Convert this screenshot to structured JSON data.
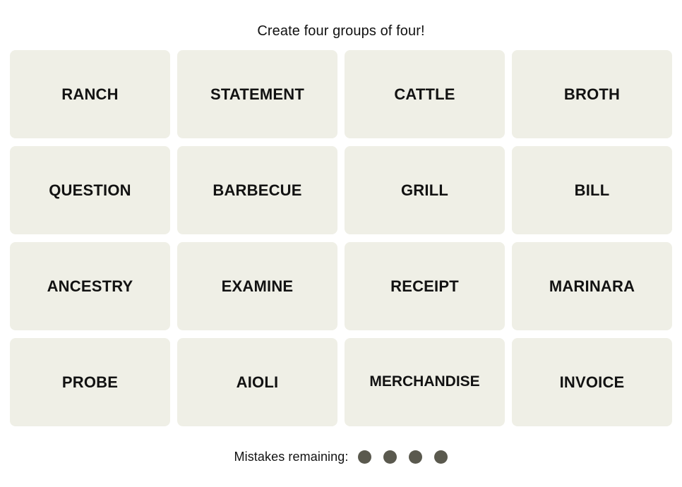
{
  "game": {
    "instruction": "Create four groups of four!",
    "tile_bg_color": "#EFEFE6",
    "tile_text_color": "#121212",
    "page_bg_color": "#FFFFFF",
    "mistake_dot_color": "#5A594E",
    "grid": {
      "rows": 4,
      "columns": 4
    },
    "tiles": [
      {
        "label": "RANCH"
      },
      {
        "label": "STATEMENT"
      },
      {
        "label": "CATTLE"
      },
      {
        "label": "BROTH"
      },
      {
        "label": "QUESTION"
      },
      {
        "label": "BARBECUE"
      },
      {
        "label": "GRILL"
      },
      {
        "label": "BILL"
      },
      {
        "label": "ANCESTRY"
      },
      {
        "label": "EXAMINE"
      },
      {
        "label": "RECEIPT"
      },
      {
        "label": "MARINARA"
      },
      {
        "label": "PROBE"
      },
      {
        "label": "AIOLI"
      },
      {
        "label": "MERCHANDISE"
      },
      {
        "label": "INVOICE"
      }
    ],
    "mistakes": {
      "label": "Mistakes remaining:",
      "remaining": 4,
      "dots": [
        1,
        2,
        3,
        4
      ]
    }
  }
}
